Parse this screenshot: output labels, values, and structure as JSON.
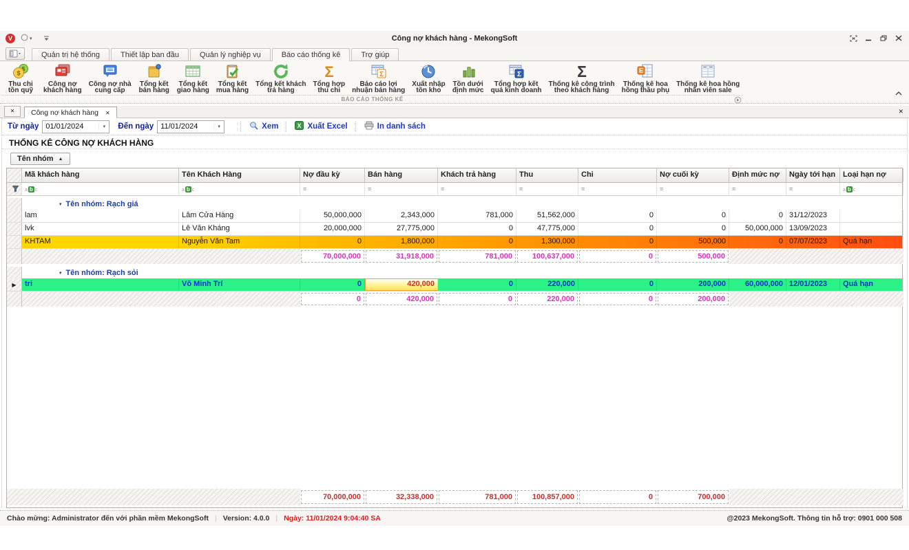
{
  "window": {
    "title": "Công nợ khách hàng - MekongSoft",
    "logo_letter": "V"
  },
  "glyphs": {
    "close": "✕",
    "dropdown": "▾",
    "sort_asc": "▲",
    "collapse_group": "▾",
    "row_pointer": "▶",
    "divider": "|"
  },
  "ribbon": {
    "tabs": [
      {
        "label": "Quản trị hệ thống",
        "active": false
      },
      {
        "label": "Thiết lập ban đầu",
        "active": false
      },
      {
        "label": "Quản lý nghiệp vụ",
        "active": false
      },
      {
        "label": "Báo cáo thống kê",
        "active": true
      },
      {
        "label": "Trợ giúp",
        "active": false
      }
    ],
    "group_label": "BÁO CÁO THỐNG KÊ",
    "buttons": [
      {
        "label": [
          "Thu chi",
          "tồn quỹ"
        ],
        "icon": "coins-icon"
      },
      {
        "label": [
          "Công nợ",
          "khách hàng"
        ],
        "icon": "customer-debt-icon"
      },
      {
        "label": [
          "Công nợ nhà",
          "cung cấp"
        ],
        "icon": "supplier-debt-icon"
      },
      {
        "label": [
          "Tổng kết",
          "bán hàng"
        ],
        "icon": "sales-notepad-icon"
      },
      {
        "label": [
          "Tổng kết",
          "giao hàng"
        ],
        "icon": "delivery-table-icon"
      },
      {
        "label": [
          "Tổng kết",
          "mua hàng"
        ],
        "icon": "purchase-clipboard-icon"
      },
      {
        "label": [
          "Tổng kết khách",
          "trả hàng"
        ],
        "icon": "returns-refresh-icon"
      },
      {
        "label": [
          "Tổng hợp",
          "thu chi"
        ],
        "icon": "sigma-orange-icon"
      },
      {
        "label": [
          "Báo cáo lợi",
          "nhuận bán hàng"
        ],
        "icon": "profit-table-sigma-icon"
      },
      {
        "label": [
          "Xuất nhập",
          "tồn kho"
        ],
        "icon": "inventory-globe-icon"
      },
      {
        "label": [
          "Tồn dưới",
          "định mức"
        ],
        "icon": "bar-chart-icon"
      },
      {
        "label": [
          "Tổng hợp kết",
          "quả kinh doanh"
        ],
        "icon": "business-table-sigma-icon"
      },
      {
        "label": [
          "Thống kê công trình",
          "theo khách hàng"
        ],
        "icon": "sigma-dark-icon"
      },
      {
        "label": [
          "Thống kê hoa",
          "hồng thầu phụ"
        ],
        "icon": "commission-table-icon"
      },
      {
        "label": [
          "Thống kê hoa hồng",
          "nhân viên sale"
        ],
        "icon": "sales-commission-table-icon"
      }
    ]
  },
  "tabstrip": {
    "active_tab": "Công nợ khách hàng"
  },
  "toolbar": {
    "from_label": "Từ ngày",
    "from_value": "01/01/2024",
    "to_label": "Đến ngày",
    "to_value": "11/01/2024",
    "view_label": "Xem",
    "excel_label": "Xuất Excel",
    "print_label": "In danh sách"
  },
  "report": {
    "heading": "THỐNG KÊ CÔNG NỢ KHÁCH HÀNG",
    "group_by": "Tên nhóm"
  },
  "grid": {
    "columns": [
      "Mã khách hàng",
      "Tên Khách Hàng",
      "Nợ đầu kỳ",
      "Bán hàng",
      "Khách trả hàng",
      "Thu",
      "Chi",
      "Nợ cuối kỳ",
      "Định mức nợ",
      "Ngày tới hạn",
      "Loại hạn nợ"
    ],
    "filter_icons": [
      "funnel-icon",
      "abc-filter-icon",
      "abc-filter-icon",
      "equals-filter-icon",
      "equals-filter-icon",
      "equals-filter-icon",
      "equals-filter-icon",
      "equals-filter-icon",
      "equals-filter-icon",
      "equals-filter-icon",
      "equals-filter-icon",
      "abc-filter-icon"
    ],
    "groups": [
      {
        "label": "Tên nhóm: Rạch giá",
        "rows": [
          {
            "code": "lam",
            "name": "Lâm Cửa Hàng",
            "values": [
              "50,000,000",
              "2,343,000",
              "781,000",
              "51,562,000",
              "0",
              "0",
              "0",
              "31/12/2023",
              ""
            ]
          },
          {
            "code": "lvk",
            "name": "Lê Văn Kháng",
            "values": [
              "20,000,000",
              "27,775,000",
              "0",
              "47,775,000",
              "0",
              "0",
              "50,000,000",
              "13/09/2023",
              ""
            ]
          },
          {
            "code": "KHTAM",
            "name": "Nguyễn Văn Tam",
            "values": [
              "0",
              "1,800,000",
              "0",
              "1,300,000",
              "0",
              "500,000",
              "0",
              "07/07/2023",
              "Quá hạn"
            ],
            "highlight": "overdue-orange"
          }
        ],
        "subtotal": [
          "70,000,000",
          "31,918,000",
          "781,000",
          "100,637,000",
          "0",
          "500,000"
        ]
      },
      {
        "label": "Tên nhóm: Rạch sỏi",
        "rows": [
          {
            "code": "tri",
            "name": "Võ Minh Trí",
            "values": [
              "0",
              "420,000",
              "0",
              "220,000",
              "0",
              "200,000",
              "60,000,000",
              "12/01/2023",
              "Quá hạn"
            ],
            "highlight": "selected-green",
            "selected": true,
            "focused_value_index": 1
          }
        ],
        "subtotal": [
          "0",
          "420,000",
          "0",
          "220,000",
          "0",
          "200,000"
        ]
      }
    ],
    "grand_total": [
      "70,000,000",
      "32,338,000",
      "781,000",
      "100,857,000",
      "0",
      "700,000"
    ]
  },
  "statusbar": {
    "welcome": "Chào mừng: Administrator đến với phần mềm MekongSoft",
    "version": "Version: 4.0.0",
    "date": "Ngày: 11/01/2024 9:04:40 SA",
    "support": "@2023 MekongSoft. Thông tin hỗ trợ: 0901 000 508"
  },
  "colors": {
    "selected_row_green": "#2CF186",
    "selected_row_text": "#0030CF",
    "overdue_row_gradient": [
      "#FFD500",
      "#FFA000",
      "#FF4D12"
    ],
    "focused_cell_yellow": "#FFE94E",
    "focused_cell_border": "#F0A32F",
    "focused_cell_text": "#D92B1F",
    "subtotal_magenta": "#E12FC2",
    "grand_total_red": "#C9302C",
    "group_label_navy": "#1B3FA8",
    "toolbar_label_navy": "#101F9E",
    "toolbar_button_blue": "#2036CC",
    "status_date_red": "#E01B1B"
  }
}
